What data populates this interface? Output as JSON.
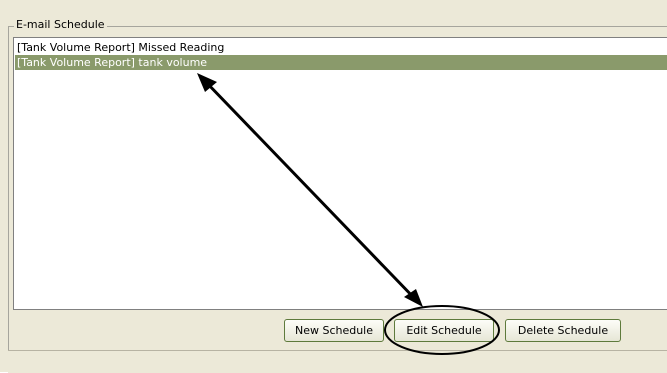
{
  "group": {
    "title": "E-mail Schedule"
  },
  "schedules": [
    {
      "label": "[Tank Volume Report] Missed Reading",
      "selected": false
    },
    {
      "label": "[Tank Volume Report] tank volume",
      "selected": true
    }
  ],
  "buttons": {
    "new_label": "New Schedule",
    "edit_label": "Edit Schedule",
    "delete_label": "Delete Schedule"
  },
  "colors": {
    "selection": "#8a9a6b",
    "annotation": "#000000"
  }
}
